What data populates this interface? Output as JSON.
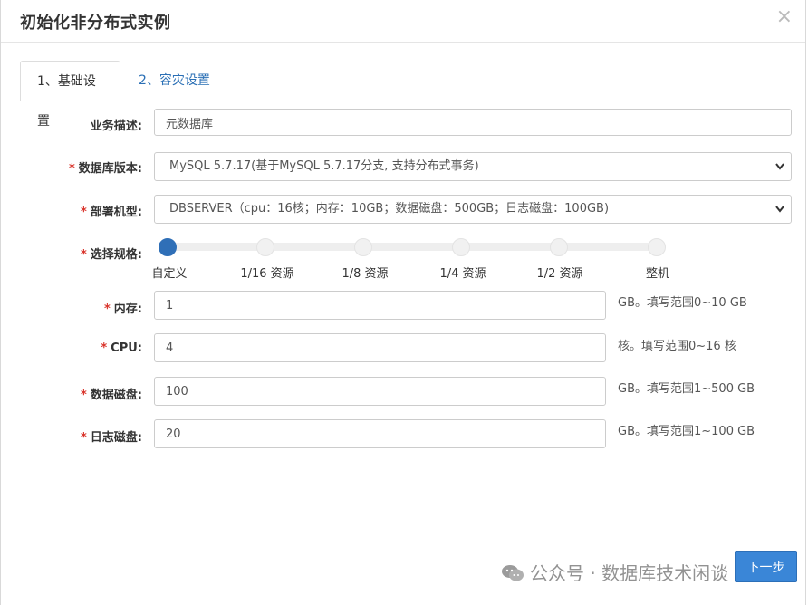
{
  "dialog": {
    "title": "初始化非分布式实例",
    "close_glyph": "×"
  },
  "tabs": [
    {
      "label": "1、基础设置",
      "active": true
    },
    {
      "label": "2、容灾设置",
      "active": false
    }
  ],
  "form": {
    "business_desc": {
      "label": "业务描述:",
      "value": "元数据库",
      "required": false
    },
    "db_version": {
      "label": "数据库版本:",
      "value": "MySQL 5.7.17(基于MySQL 5.7.17分支, 支持分布式事务)",
      "required": true
    },
    "deploy_machine": {
      "label": "部署机型:",
      "value": "DBSERVER（cpu：16核；内存：10GB；数据磁盘：500GB；日志磁盘：100GB)",
      "required": true
    },
    "spec": {
      "label": "选择规格:",
      "required": true,
      "options": [
        "自定义",
        "1/16 资源",
        "1/8 资源",
        "1/4 资源",
        "1/2 资源",
        "整机"
      ],
      "selected_index": 0
    },
    "memory": {
      "label": "内存:",
      "value": "1",
      "hint": "GB。填写范围0~10 GB",
      "required": true
    },
    "cpu": {
      "label": "CPU:",
      "value": "4",
      "hint": "核。填写范围0~16 核",
      "required": true
    },
    "data_disk": {
      "label": "数据磁盘:",
      "value": "100",
      "hint": "GB。填写范围1~500 GB",
      "required": true
    },
    "log_disk": {
      "label": "日志磁盘:",
      "value": "20",
      "hint": "GB。填写范围1~100 GB",
      "required": true
    },
    "required_mark": "*"
  },
  "footer": {
    "next_label": "下一步"
  },
  "watermark": {
    "text": "公众号 · 数据库技术闲谈",
    "icon": "wechat-icon"
  },
  "colors": {
    "accent": "#3a86d7",
    "required": "#d9332a",
    "tab_link": "#2a6fb5"
  }
}
